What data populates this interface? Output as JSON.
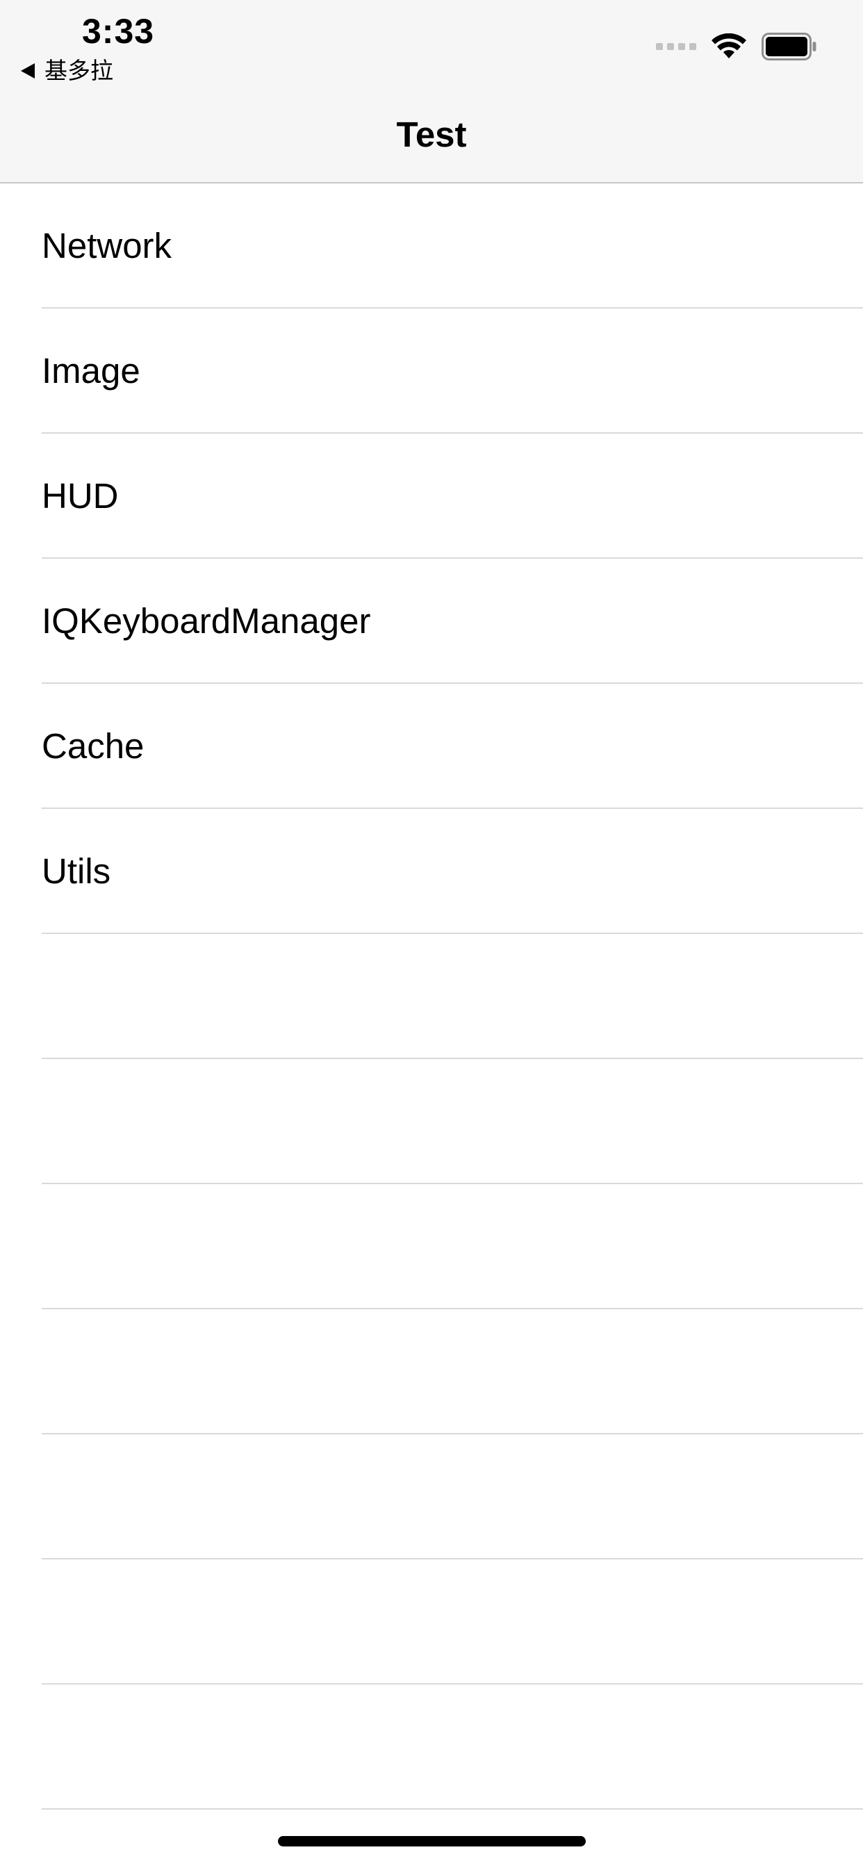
{
  "status_bar": {
    "time": "3:33",
    "back_app_label": "基多拉"
  },
  "nav": {
    "title": "Test"
  },
  "table": {
    "rows": [
      {
        "label": "Network"
      },
      {
        "label": "Image"
      },
      {
        "label": "HUD"
      },
      {
        "label": "IQKeyboardManager"
      },
      {
        "label": "Cache"
      },
      {
        "label": "Utils"
      },
      {
        "label": ""
      },
      {
        "label": ""
      },
      {
        "label": ""
      },
      {
        "label": ""
      },
      {
        "label": ""
      },
      {
        "label": ""
      },
      {
        "label": ""
      }
    ]
  },
  "icons": {
    "back": "back-arrow-icon",
    "signal": "cellular-signal-icon",
    "wifi": "wifi-icon",
    "battery": "battery-icon"
  },
  "colors": {
    "nav_background": "#f6f6f6",
    "separator": "#d9d9dc",
    "text": "#000000"
  }
}
